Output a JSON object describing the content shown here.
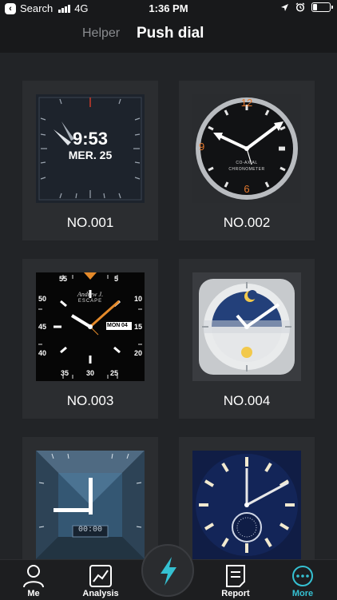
{
  "status": {
    "carrier": "Search",
    "network": "4G",
    "time": "1:36 PM"
  },
  "header": {
    "tabs": [
      {
        "label": "Helper",
        "active": false
      },
      {
        "label": "Push dial",
        "active": true
      }
    ]
  },
  "dials": [
    {
      "label": "NO.001",
      "time": "9:53",
      "date": "MER. 25"
    },
    {
      "label": "NO.002",
      "brand": "CO-AXIAL",
      "sub": "CHRONOMETER",
      "numerals": [
        "12",
        "3",
        "6",
        "9"
      ]
    },
    {
      "label": "NO.003",
      "brand": "Andrew J.",
      "sub": "ESCAPE",
      "day": "MON",
      "date_num": "04",
      "numerals": [
        "55",
        "5",
        "50",
        "10",
        "45",
        "15",
        "40",
        "20",
        "35",
        "30",
        "25"
      ]
    },
    {
      "label": "NO.004"
    },
    {
      "label": "NO.005",
      "time": "00:00"
    },
    {
      "label": "NO.006"
    }
  ],
  "tabbar": {
    "items": [
      {
        "label": "Me",
        "icon": "person-icon"
      },
      {
        "label": "Analysis",
        "icon": "chart-icon"
      },
      {
        "label": "",
        "icon": "lightning-icon"
      },
      {
        "label": "Report",
        "icon": "report-icon"
      },
      {
        "label": "More",
        "icon": "more-icon"
      }
    ]
  },
  "colors": {
    "accent": "#35c1d2",
    "card": "#2b2d30",
    "background": "#222427"
  }
}
